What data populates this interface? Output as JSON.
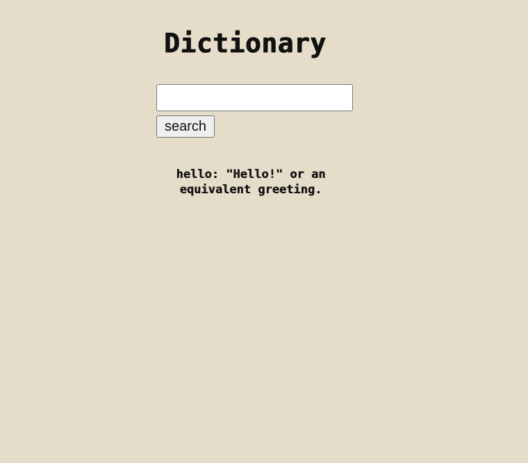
{
  "app": {
    "title": "Dictionary"
  },
  "search": {
    "value": "",
    "button_label": "search"
  },
  "result": {
    "text": "hello: \"Hello!\" or an equivalent greeting."
  },
  "colors": {
    "background": "#e5ddca",
    "text": "#111111"
  }
}
